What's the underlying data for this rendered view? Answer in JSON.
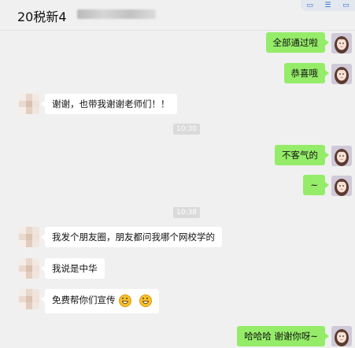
{
  "header": {
    "title": "20税新4"
  },
  "corner_tools": [
    "▭",
    "☰",
    "▭"
  ],
  "messages": [
    {
      "side": "right",
      "text": "全部通过啦"
    },
    {
      "side": "right",
      "text": "恭喜哦"
    },
    {
      "side": "left",
      "text": "谢谢，也带我谢谢老师们！！"
    },
    {
      "side": "time",
      "text": "10:30"
    },
    {
      "side": "right",
      "text": "不客气的"
    },
    {
      "side": "right",
      "text": "~"
    },
    {
      "side": "time",
      "text": "10:38"
    },
    {
      "side": "left",
      "text": "我发个朋友圈，朋友都问我哪个网校学的"
    },
    {
      "side": "left",
      "text": "我说是中华"
    },
    {
      "side": "left",
      "text": "免费帮你们宣传",
      "emoji": [
        "grin-emoji",
        "grin-emoji"
      ]
    },
    {
      "side": "right",
      "text": "哈哈哈  谢谢你呀~"
    }
  ],
  "colors": {
    "self_bubble": "#95ec69",
    "other_bubble": "#ffffff",
    "background": "#f0f0f0"
  }
}
